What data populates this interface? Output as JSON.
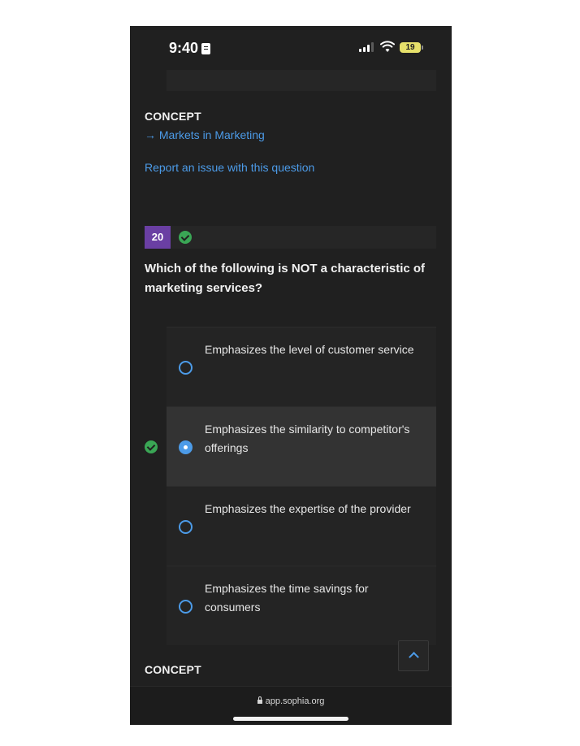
{
  "status_bar": {
    "time": "9:40",
    "battery": "19"
  },
  "concept_top": {
    "label": "CONCEPT",
    "link": "→ Markets in Marketing"
  },
  "report_link": "Report an issue with this question",
  "question": {
    "number": "20",
    "text": "Which of the following is NOT a characteristic of marketing services?",
    "options": [
      {
        "text": "Emphasizes the level of customer service",
        "selected": false
      },
      {
        "text": "Emphasizes the similarity to competitor's offerings",
        "selected": true
      },
      {
        "text": "Emphasizes the expertise of the provider",
        "selected": false
      },
      {
        "text": "Emphasizes the time savings for consumers",
        "selected": false
      }
    ]
  },
  "concept_bottom": {
    "label": "CONCEPT"
  },
  "browser": {
    "url": "app.sophia.org"
  },
  "colors": {
    "background": "#202020",
    "link": "#4c9be8",
    "badge": "#6a3fa3",
    "correct": "#3aa655"
  },
  "icons": [
    "status-lock-icon",
    "signal-icon",
    "wifi-icon",
    "battery-icon",
    "check-icon",
    "radio-icon",
    "chevron-up-icon",
    "lock-icon"
  ]
}
